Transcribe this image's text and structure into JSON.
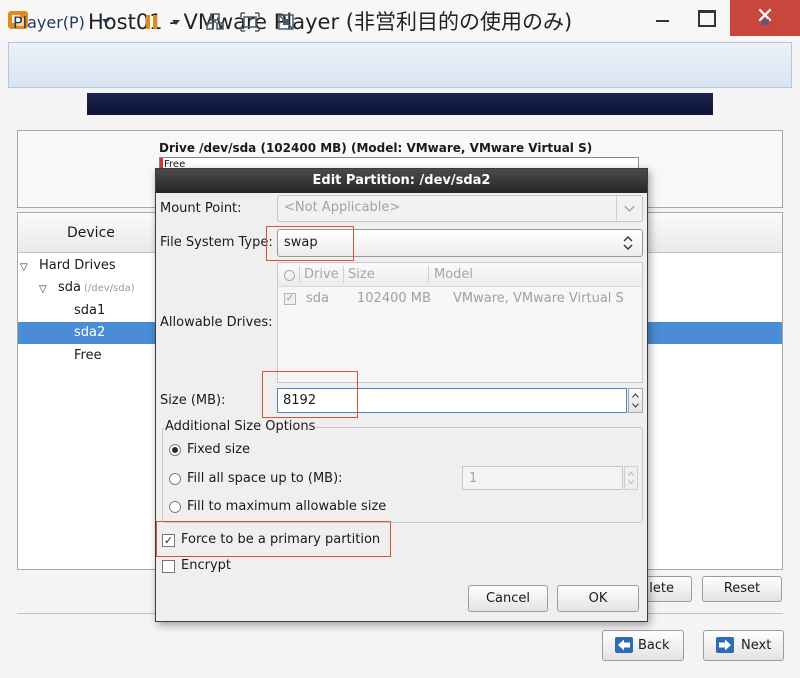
{
  "window": {
    "title": "Host01 - VMware Player (非営利目的の使用のみ)",
    "close_glyph": "✕"
  },
  "toolbar": {
    "player_menu_label": "Player(P)",
    "collapse_glyph": "«"
  },
  "installer": {
    "drive_title": "Drive /dev/sda (102400 MB) (Model: VMware, VMware Virtual S)",
    "drive_bar_label": "Free",
    "device_column": "Device",
    "tree": {
      "hard_drives": "Hard Drives",
      "disk": "sda",
      "disk_path": "(/dev/sda)",
      "partitions": [
        "sda1",
        "sda2",
        "Free"
      ],
      "selected": "sda2"
    },
    "delete_label": "lete",
    "reset_label": "Reset",
    "back_label": "Back",
    "next_label": "Next"
  },
  "dialog": {
    "title": "Edit Partition: /dev/sda2",
    "mount_point": {
      "label": "Mount Point:",
      "placeholder": "<Not Applicable>"
    },
    "fs_type": {
      "label": "File System Type:",
      "value": "swap"
    },
    "allowable_drives": {
      "label": "Allowable Drives:",
      "columns": [
        "Drive",
        "Size",
        "Model"
      ],
      "rows": [
        {
          "drive": "sda",
          "size": "102400 MB",
          "model": "VMware, VMware Virtual S",
          "checked": true
        }
      ]
    },
    "size": {
      "label": "Size (MB):",
      "value": "8192"
    },
    "additional_size": {
      "legend": "Additional Size Options",
      "options": [
        {
          "label": "Fixed size",
          "selected": true
        },
        {
          "label": "Fill all space up to (MB):",
          "selected": false
        },
        {
          "label": "Fill to maximum allowable size",
          "selected": false
        }
      ],
      "fill_up_to_value": "1"
    },
    "force_primary": {
      "label": "Force to be a primary partition",
      "checked": true
    },
    "encrypt": {
      "label": "Encrypt",
      "checked": false
    },
    "cancel_label": "Cancel",
    "ok_label": "OK"
  },
  "colors": {
    "highlight": "#d3552e",
    "selection": "#4a8cd6",
    "close_button": "#c9463d"
  }
}
